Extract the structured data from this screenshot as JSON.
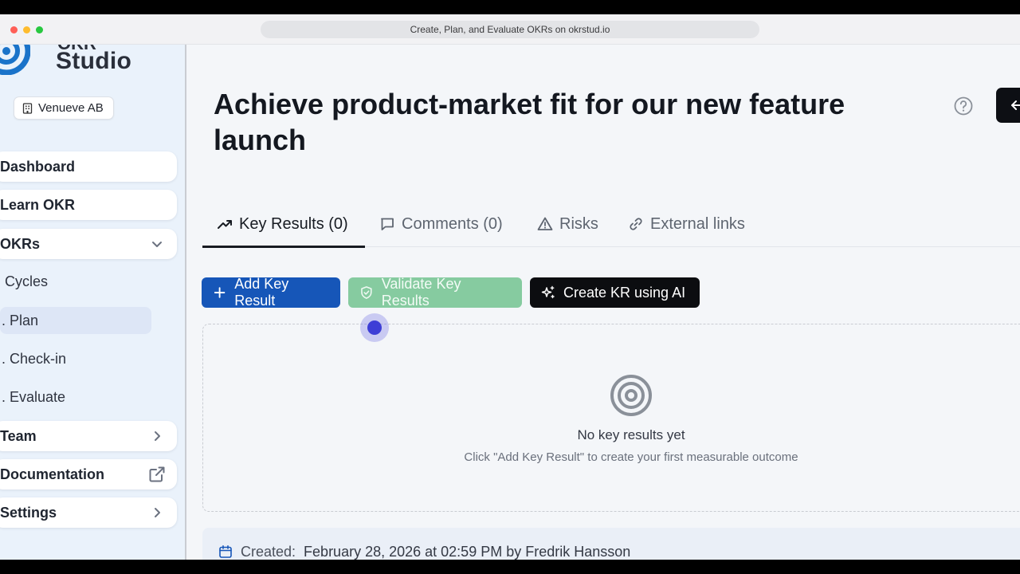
{
  "browser": {
    "url_title": "Create, Plan, and Evaluate OKRs on okrstud.io"
  },
  "sidebar": {
    "logo_top": "OKR",
    "logo_text": "Studio",
    "organization": "Venueve AB",
    "nav": [
      {
        "label": "Dashboard"
      },
      {
        "label": "Learn OKR"
      },
      {
        "label": "OKRs",
        "icon": "chevron-down-icon"
      },
      {
        "label": "Team",
        "icon": "chevron-right-icon"
      },
      {
        "label": "Documentation",
        "icon": "external-link-icon"
      },
      {
        "label": "Settings",
        "icon": "chevron-right-icon"
      }
    ],
    "okr_subitems": [
      {
        "label": "Cycles"
      },
      {
        "label": ". Plan",
        "active": true
      },
      {
        "label": ". Check-in"
      },
      {
        "label": ". Evaluate"
      }
    ]
  },
  "main": {
    "title": "Achieve product-market fit for our new feature launch",
    "tabs": [
      {
        "label": "Key Results (0)",
        "icon": "trending-up-icon",
        "active": true
      },
      {
        "label": "Comments (0)",
        "icon": "comment-icon"
      },
      {
        "label": "Risks",
        "icon": "warning-icon"
      },
      {
        "label": "External links",
        "icon": "link-icon"
      }
    ],
    "actions": {
      "add_label": "Add Key Result",
      "validate_label": "Validate Key Results",
      "ai_label": "Create KR using AI"
    },
    "empty_state": {
      "title": "No key results yet",
      "subtitle": "Click \"Add Key Result\" to create your first measurable outcome"
    },
    "meta": {
      "created_label": "Created:",
      "created_value": "February 28, 2026 at 02:59 PM by Fredrik Hansson"
    }
  },
  "colors": {
    "primary": "#1656b8",
    "validate": "#86cba0",
    "ai_button": "#0c0d10",
    "sidebar_bg": "#eaf2fb"
  }
}
